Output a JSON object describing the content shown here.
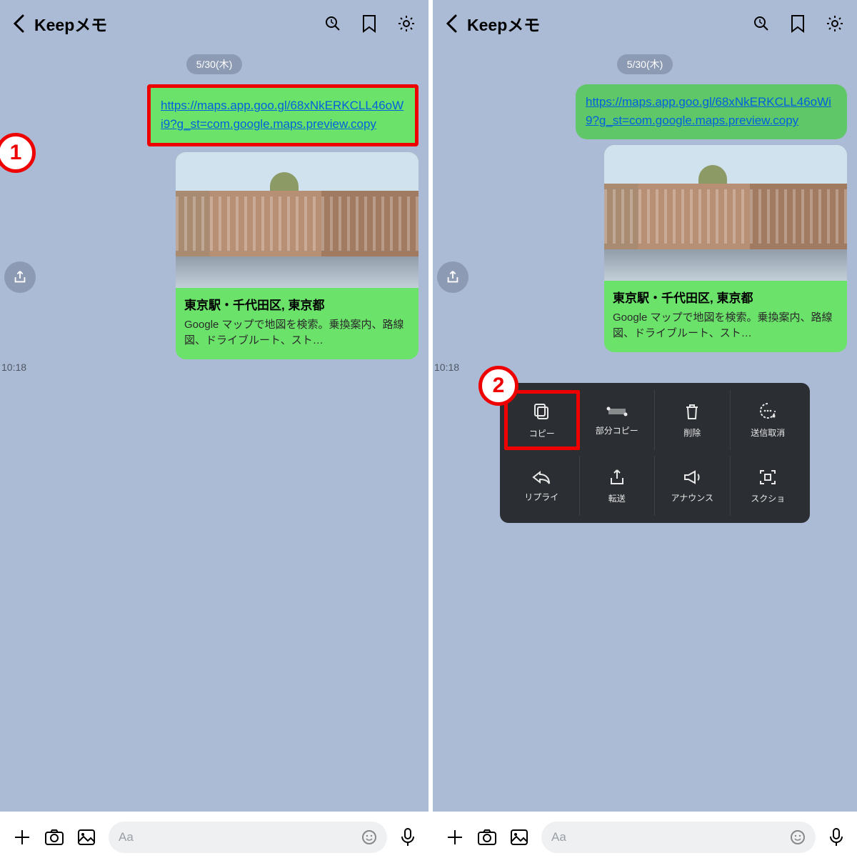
{
  "header": {
    "title": "Keepメモ"
  },
  "chat": {
    "date": "5/30(木)",
    "link_text": "https://maps.app.goo.gl/68xNkERKCLL46oWi9?g_st=com.google.maps.preview.copy",
    "link_href": "https://maps.app.goo.gl/68xNkERKCLL46oWi9?g_st=com.google.maps.preview.copy",
    "timestamp": "10:18",
    "preview": {
      "title": "東京駅・千代田区, 東京都",
      "description": "Google マップで地図を検索。乗換案内、路線図、ドライブルート、スト…"
    }
  },
  "context_menu": {
    "items": [
      {
        "label": "コピー",
        "icon": "copy"
      },
      {
        "label": "部分コピー",
        "icon": "partial"
      },
      {
        "label": "削除",
        "icon": "trash"
      },
      {
        "label": "送信取消",
        "icon": "unsend"
      },
      {
        "label": "リプライ",
        "icon": "reply"
      },
      {
        "label": "転送",
        "icon": "share"
      },
      {
        "label": "アナウンス",
        "icon": "announce"
      },
      {
        "label": "スクショ",
        "icon": "screenshot"
      }
    ]
  },
  "input": {
    "placeholder": "Aa"
  },
  "annotations": {
    "step1": "1",
    "step2": "2"
  }
}
